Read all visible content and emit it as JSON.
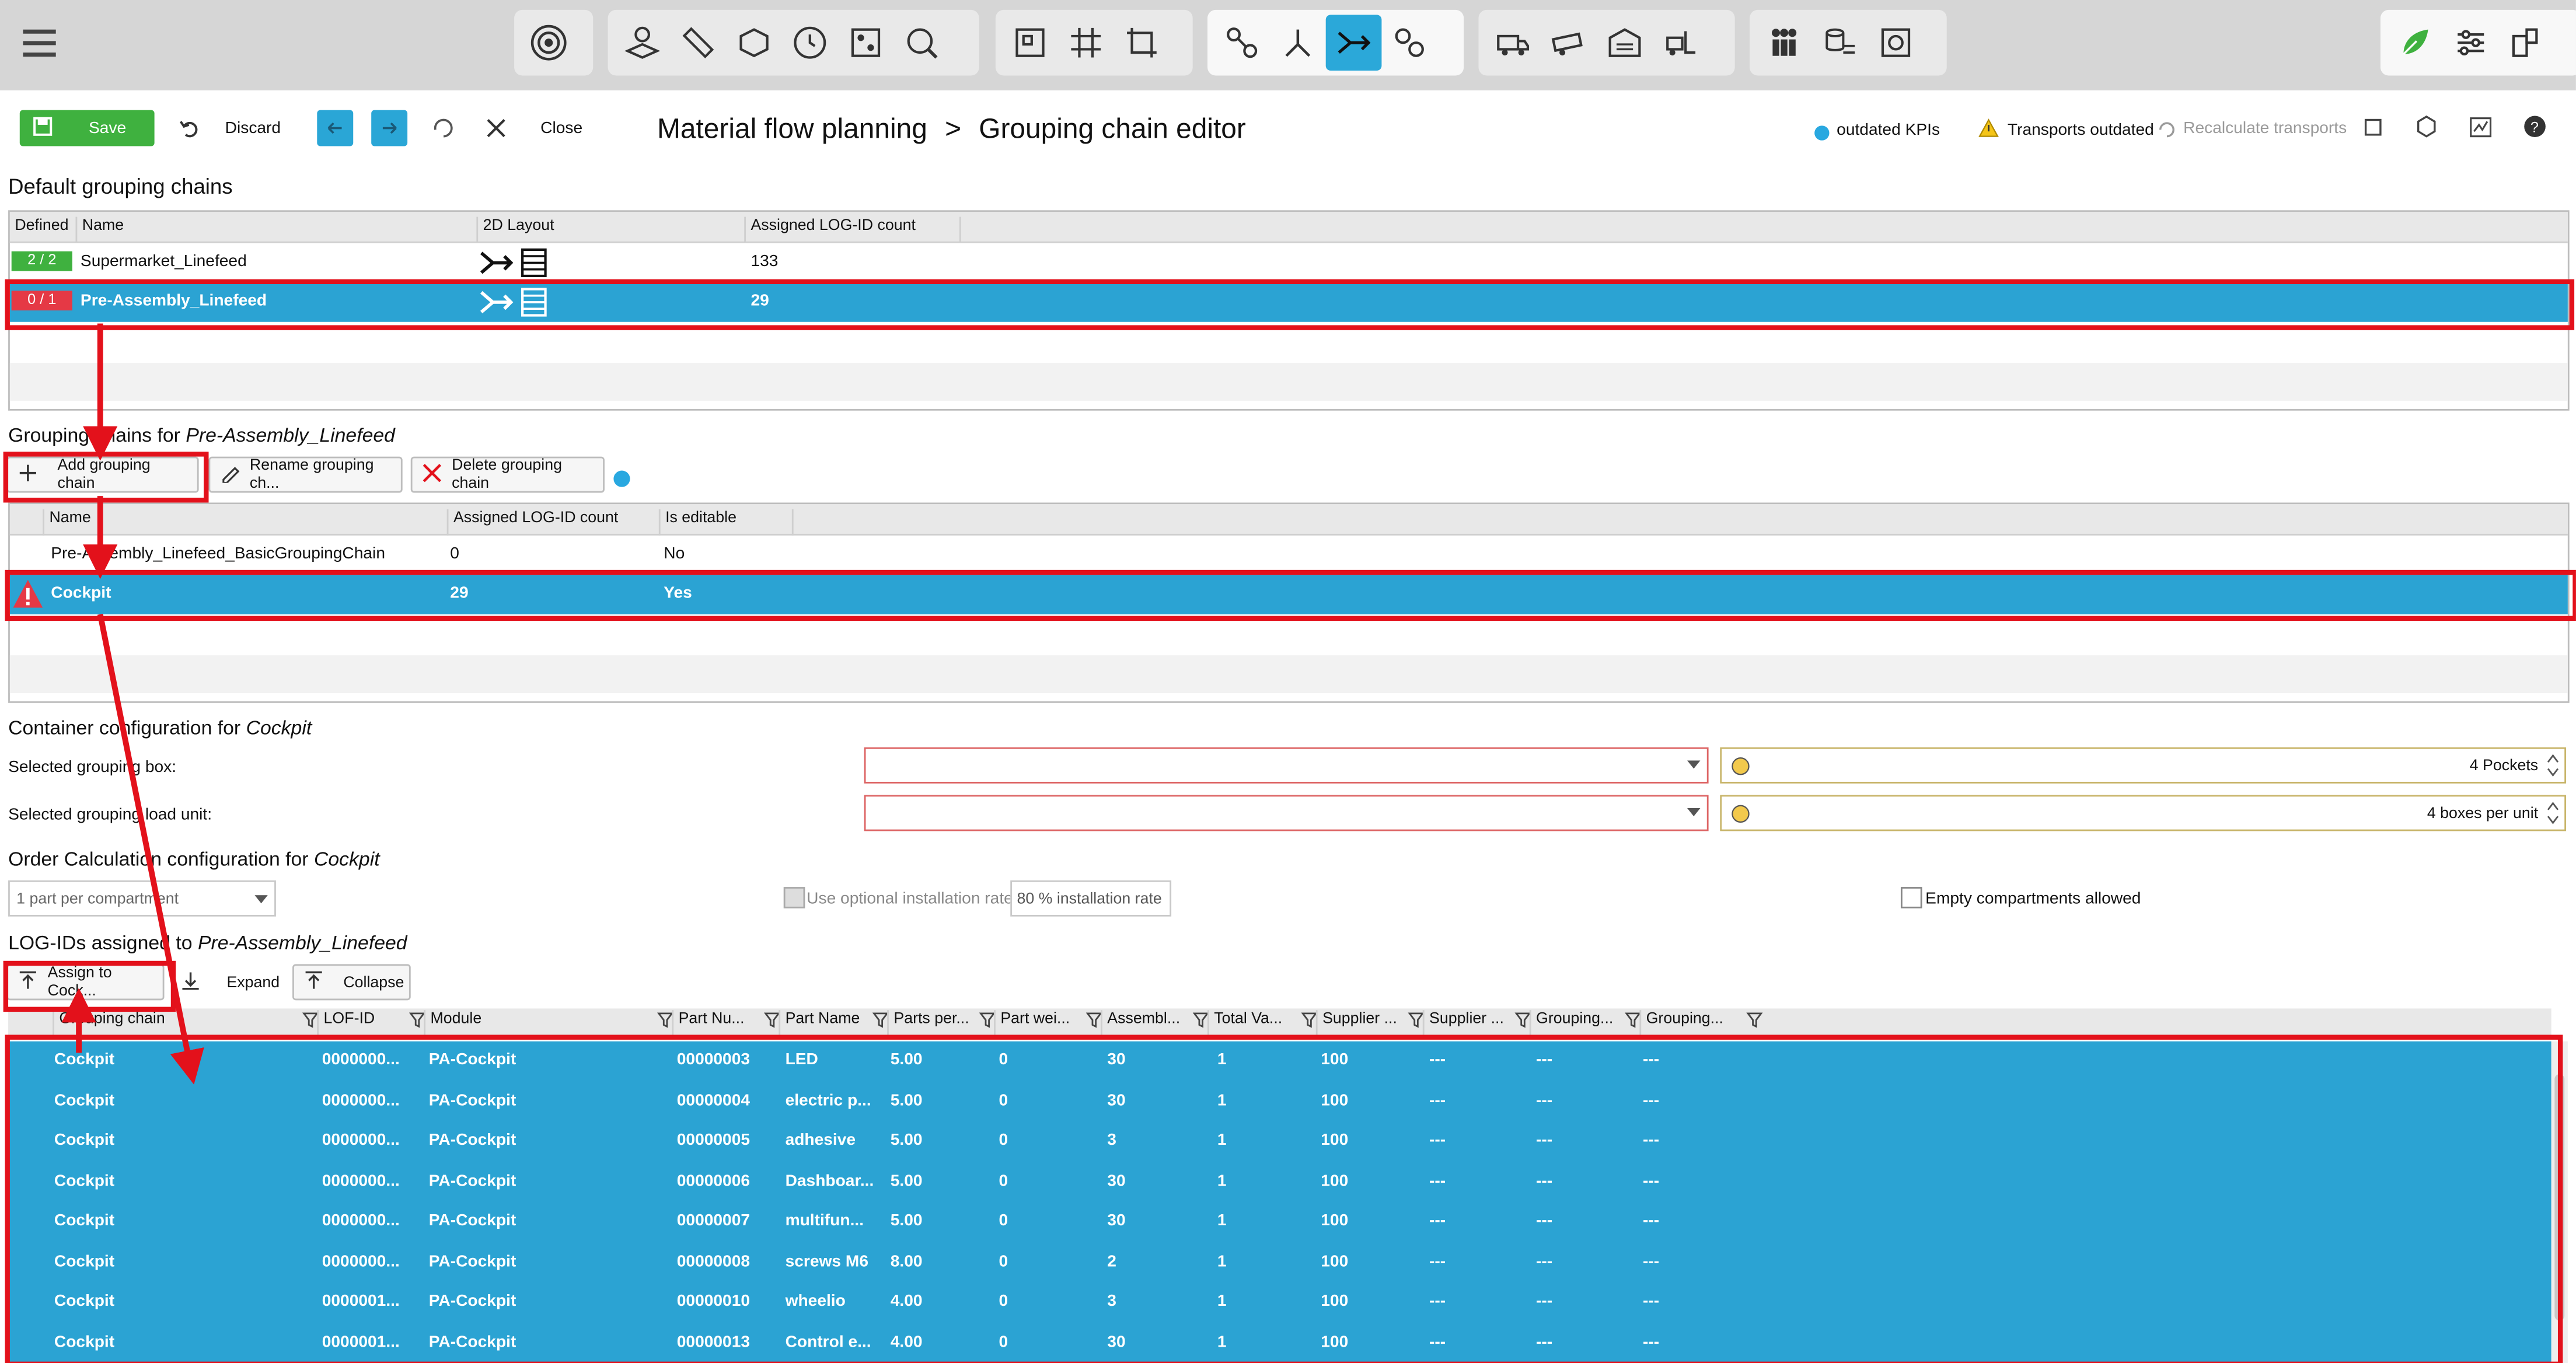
{
  "toolbar_groups": {
    "g1": [
      "target-icon"
    ],
    "g2": [
      "layout-icon",
      "ruler-icon",
      "cube-edit-icon",
      "clock-icon",
      "grid-dots-icon",
      "search-cycle-icon"
    ],
    "g3": [
      "frame-icon",
      "hash-grid-icon",
      "crop-icon"
    ],
    "g4": [
      "link-icon",
      "branch-icon",
      "merge-arrow-icon",
      "chain-link-icon"
    ],
    "g5": [
      "truck-icon",
      "trailer-icon",
      "warehouse-icon",
      "forklift-icon"
    ],
    "g6": [
      "people-icon",
      "coins-stack-icon",
      "gear-box-icon"
    ],
    "right": [
      "leaf-icon",
      "sliders-icon",
      "layout-mf-icon"
    ]
  },
  "actionbar": {
    "save": "Save",
    "discard": "Discard",
    "close": "Close",
    "breadcrumb_root": "Material flow planning",
    "breadcrumb_sep": ">",
    "breadcrumb_current": "Grouping chain editor",
    "outdated_kpis": "outdated KPIs",
    "transports_outdated": "Transports outdated",
    "recalculate": "Recalculate transports"
  },
  "default_chains": {
    "title": "Default grouping chains",
    "columns": [
      "Defined",
      "Name",
      "2D Layout",
      "Assigned LOG-ID count"
    ],
    "rows": [
      {
        "defined": "2 / 2",
        "name": "Supermarket_Linefeed",
        "count": "133",
        "defined_color": "#3fb13f"
      },
      {
        "defined": "0 / 1",
        "name": "Pre-Assembly_Linefeed",
        "count": "29",
        "defined_color": "#e53945"
      }
    ]
  },
  "grouping_chains": {
    "title_prefix": "Grouping chains for",
    "title_target": "Pre-Assembly_Linefeed",
    "add": "Add grouping chain",
    "rename": "Rename grouping ch...",
    "delete": "Delete grouping chain",
    "columns": [
      "Name",
      "Assigned LOG-ID count",
      "Is editable"
    ],
    "rows": [
      {
        "name": "Pre-Assembly_Linefeed_BasicGroupingChain",
        "count": "0",
        "editable": "No"
      },
      {
        "name": "Cockpit",
        "count": "29",
        "editable": "Yes"
      }
    ]
  },
  "container_config": {
    "title_prefix": "Container configuration for",
    "title_target": "Cockpit",
    "box_label": "Selected grouping box:",
    "load_label": "Selected grouping load unit:",
    "pockets": "4 Pockets",
    "boxes": "4 boxes per unit"
  },
  "order_calc": {
    "title_prefix": "Order Calculation configuration for",
    "title_target": "Cockpit",
    "parts_select": "1 part per compartment",
    "use_optional": "Use optional installation rate",
    "rate_value": "80 % installation rate",
    "empty_allowed": "Empty compartments allowed"
  },
  "logids": {
    "title_prefix": "LOG-IDs assigned to",
    "title_target": "Pre-Assembly_Linefeed",
    "assign": "Assign to Cock...",
    "expand": "Expand",
    "collapse": "Collapse",
    "columns": [
      "Grouping chain",
      "LOF-ID",
      "Module",
      "Part Nu...",
      "Part Name",
      "Parts per...",
      "Part wei...",
      "Assembl...",
      "Total Va...",
      "Supplier ...",
      "Supplier ...",
      "Grouping...",
      "Grouping..."
    ],
    "rows": [
      [
        "Cockpit",
        "0000000...",
        "PA-Cockpit",
        "00000003",
        "LED",
        "5.00",
        "0",
        "30",
        "1",
        "100",
        "---",
        "---",
        "---"
      ],
      [
        "Cockpit",
        "0000000...",
        "PA-Cockpit",
        "00000004",
        "electric p...",
        "5.00",
        "0",
        "30",
        "1",
        "100",
        "---",
        "---",
        "---"
      ],
      [
        "Cockpit",
        "0000000...",
        "PA-Cockpit",
        "00000005",
        "adhesive",
        "5.00",
        "0",
        "3",
        "1",
        "100",
        "---",
        "---",
        "---"
      ],
      [
        "Cockpit",
        "0000000...",
        "PA-Cockpit",
        "00000006",
        "Dashboar...",
        "5.00",
        "0",
        "30",
        "1",
        "100",
        "---",
        "---",
        "---"
      ],
      [
        "Cockpit",
        "0000000...",
        "PA-Cockpit",
        "00000007",
        "multifun...",
        "5.00",
        "0",
        "30",
        "1",
        "100",
        "---",
        "---",
        "---"
      ],
      [
        "Cockpit",
        "0000000...",
        "PA-Cockpit",
        "00000008",
        "screws M6",
        "8.00",
        "0",
        "2",
        "1",
        "100",
        "---",
        "---",
        "---"
      ],
      [
        "Cockpit",
        "0000001...",
        "PA-Cockpit",
        "00000010",
        "wheelio",
        "4.00",
        "0",
        "3",
        "1",
        "100",
        "---",
        "---",
        "---"
      ],
      [
        "Cockpit",
        "0000001...",
        "PA-Cockpit",
        "00000013",
        "Control e...",
        "4.00",
        "0",
        "30",
        "1",
        "100",
        "---",
        "---",
        "---"
      ]
    ]
  },
  "colors": {
    "accent": "#2ba3d3",
    "annotation": "#e3111b",
    "save": "#3fb13f"
  }
}
